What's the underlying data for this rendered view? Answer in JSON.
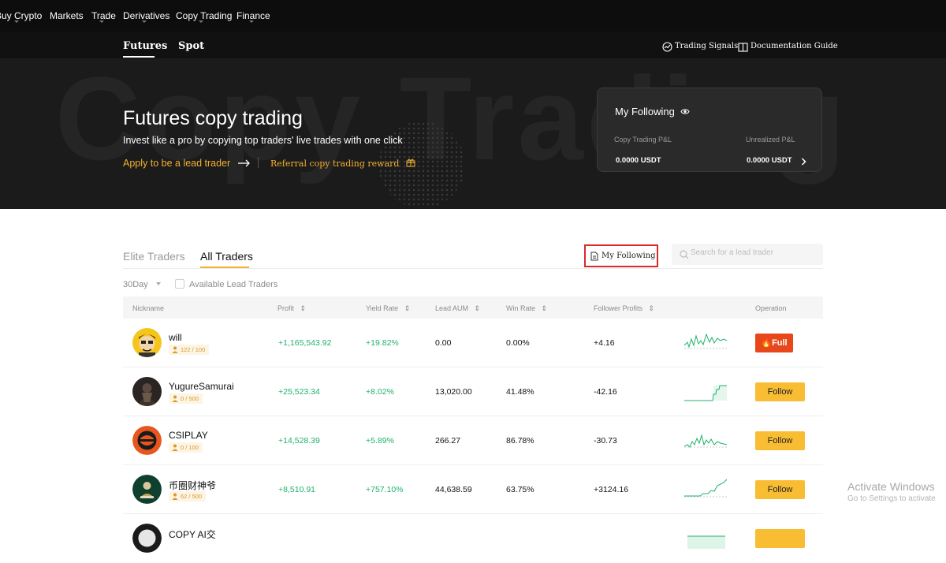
{
  "topnav": {
    "items": [
      {
        "label": "Buy Crypto",
        "caret": true
      },
      {
        "label": "Markets",
        "caret": false
      },
      {
        "label": "Trade",
        "caret": true
      },
      {
        "label": "Derivatives",
        "caret": true
      },
      {
        "label": "Copy Trading",
        "caret": true
      },
      {
        "label": "Finance",
        "caret": true
      }
    ]
  },
  "subnav": {
    "tabs": [
      "Futures",
      "Spot"
    ],
    "active_tab": "Futures",
    "links": [
      "Trading Signals",
      "Documentation Guide"
    ]
  },
  "hero": {
    "bg_word": "Copy Trading",
    "title": "Futures copy trading",
    "subtitle": "Invest like a pro by copying top traders' live trades with one click",
    "apply_link": "Apply to be a lead trader",
    "referral_link": "Referral copy trading reward"
  },
  "following_card": {
    "title": "My Following",
    "copy_pnl_label": "Copy Trading P&L",
    "copy_pnl_value": "0.0000 USDT",
    "unrealized_label": "Unrealized P&L",
    "unrealized_value": "0.0000 USDT"
  },
  "tabs": {
    "elite": "Elite Traders",
    "all": "All Traders",
    "active": "All Traders"
  },
  "my_following_button": "My Following",
  "search": {
    "placeholder": "Search for a lead trader"
  },
  "filters": {
    "period": "30Day",
    "available_label": "Available Lead Traders",
    "available_checked": false
  },
  "table": {
    "columns": [
      "Nickname",
      "Profit",
      "Yield Rate",
      "Lead AUM",
      "Win Rate",
      "Follower Profits",
      "Operation"
    ],
    "rows": [
      {
        "nickname": "will",
        "followers": "122 / 100",
        "profit": "+1,165,543.92",
        "yield_rate": "+19.82%",
        "lead_aum": "0.00",
        "win_rate": "0.00%",
        "follower_profits": "+4.16",
        "operation": "Full"
      },
      {
        "nickname": "YugureSamurai",
        "followers": "0 / 500",
        "profit": "+25,523.34",
        "yield_rate": "+8.02%",
        "lead_aum": "13,020.00",
        "win_rate": "41.48%",
        "follower_profits": "-42.16",
        "operation": "Follow"
      },
      {
        "nickname": "CSIPLAY",
        "followers": "0 / 100",
        "profit": "+14,528.39",
        "yield_rate": "+5.89%",
        "lead_aum": "266.27",
        "win_rate": "86.78%",
        "follower_profits": "-30.73",
        "operation": "Follow"
      },
      {
        "nickname": "币圈财神爷",
        "followers": "62 / 500",
        "profit": "+8,510.91",
        "yield_rate": "+757.10%",
        "lead_aum": "44,638.59",
        "win_rate": "63.75%",
        "follower_profits": "+3124.16",
        "operation": "Follow"
      },
      {
        "nickname": "COPY AI交",
        "followers": "",
        "profit": "",
        "yield_rate": "",
        "lead_aum": "",
        "win_rate": "",
        "follower_profits": "",
        "operation": ""
      }
    ]
  },
  "colors": {
    "accent": "#f5b130",
    "positive": "#20b26c",
    "negative": "#e8471b",
    "follow_button": "#f8bd33",
    "highlight_box": "#d62b2b"
  },
  "watermark": {
    "line1": "Activate Windows",
    "line2": "Go to Settings to activate"
  }
}
